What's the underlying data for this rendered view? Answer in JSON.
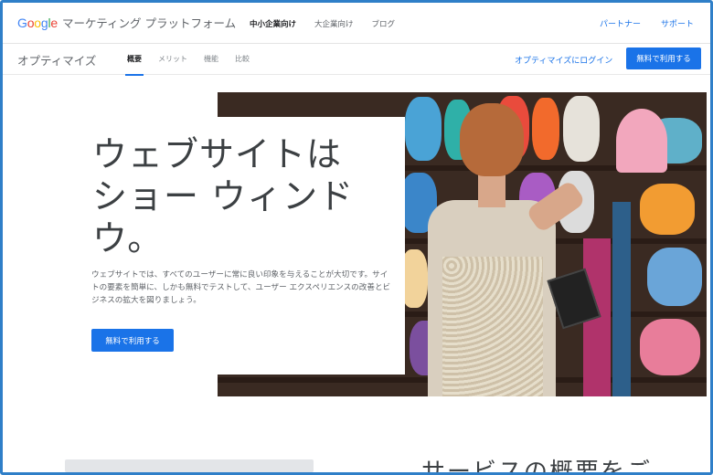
{
  "header": {
    "logo_google": "Google",
    "logo_product": "マーケティング プラットフォーム",
    "nav": [
      "中小企業向け",
      "大企業向け",
      "ブログ"
    ],
    "right_links": [
      "パートナー",
      "サポート"
    ]
  },
  "subheader": {
    "title": "オプティマイズ",
    "tabs": [
      "概要",
      "メリット",
      "機能",
      "比較"
    ],
    "login_link": "オプティマイズにログイン",
    "cta": "無料で利用する"
  },
  "hero": {
    "title": "ウェブサイトは ショー ウィンド ウ。",
    "description": "ウェブサイトでは、すべてのユーザーに常に良い印象を与えることが大切です。サイトの要素を簡単に、しかも無料でテストして、ユーザー エクスペリエンスの改善とビジネスの拡大を図りましょう。",
    "cta": "無料で利用する"
  },
  "section": {
    "heading": "サービスの概要をご"
  },
  "colors": {
    "accent": "#1a73e8",
    "border": "#2f7fc8",
    "text_dark": "#3c4043",
    "text_muted": "#5f6368"
  }
}
